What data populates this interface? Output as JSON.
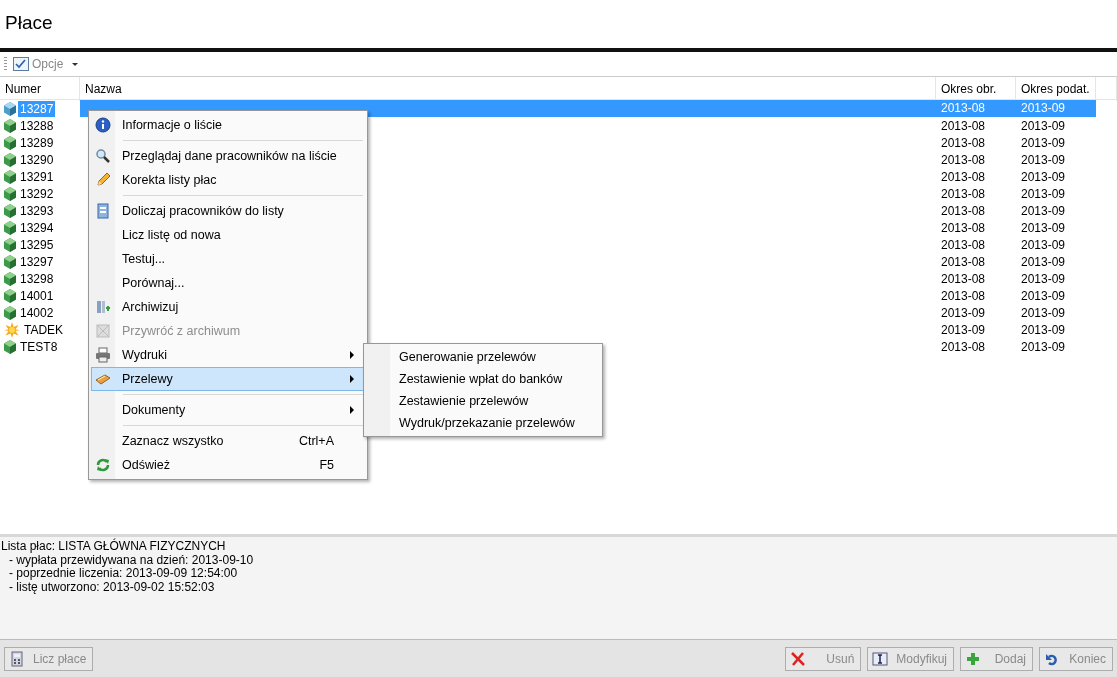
{
  "window": {
    "title": "Płace"
  },
  "toolbar": {
    "options_button": "Opcje"
  },
  "table": {
    "columns": [
      "Numer",
      "Nazwa",
      "Okres obr.",
      "Okres podat."
    ],
    "rows": [
      {
        "numer": "13287",
        "okres_obr": "2013-08",
        "okres_podat": "2013-09",
        "selected": true,
        "kind": "list"
      },
      {
        "numer": "13288",
        "okres_obr": "2013-08",
        "okres_podat": "2013-09",
        "selected": false,
        "kind": "list"
      },
      {
        "numer": "13289",
        "okres_obr": "2013-08",
        "okres_podat": "2013-09",
        "selected": false,
        "kind": "list"
      },
      {
        "numer": "13290",
        "okres_obr": "2013-08",
        "okres_podat": "2013-09",
        "selected": false,
        "kind": "list"
      },
      {
        "numer": "13291",
        "okres_obr": "2013-08",
        "okres_podat": "2013-09",
        "selected": false,
        "kind": "list"
      },
      {
        "numer": "13292",
        "okres_obr": "2013-08",
        "okres_podat": "2013-09",
        "selected": false,
        "kind": "list"
      },
      {
        "numer": "13293",
        "okres_obr": "2013-08",
        "okres_podat": "2013-09",
        "selected": false,
        "kind": "list"
      },
      {
        "numer": "13294",
        "okres_obr": "2013-08",
        "okres_podat": "2013-09",
        "selected": false,
        "kind": "list"
      },
      {
        "numer": "13295",
        "okres_obr": "2013-08",
        "okres_podat": "2013-09",
        "selected": false,
        "kind": "list"
      },
      {
        "numer": "13297",
        "okres_obr": "2013-08",
        "okres_podat": "2013-09",
        "selected": false,
        "kind": "list"
      },
      {
        "numer": "13298",
        "okres_obr": "2013-08",
        "okres_podat": "2013-09",
        "selected": false,
        "kind": "list"
      },
      {
        "numer": "14001",
        "okres_obr": "2013-08",
        "okres_podat": "2013-09",
        "selected": false,
        "kind": "list"
      },
      {
        "numer": "14002",
        "okres_obr": "2013-09",
        "okres_podat": "2013-09",
        "selected": false,
        "kind": "list"
      },
      {
        "numer": "TADEK",
        "okres_obr": "2013-09",
        "okres_podat": "2013-09",
        "selected": false,
        "kind": "star"
      },
      {
        "numer": "TEST8",
        "okres_obr": "2013-08",
        "okres_podat": "2013-09",
        "selected": false,
        "kind": "list"
      }
    ]
  },
  "context_menu": {
    "items": [
      {
        "kind": "info",
        "label": "Informacje o liście",
        "disabled": false,
        "selected": false,
        "submenu": false
      },
      {
        "kind": "separator"
      },
      {
        "kind": "search",
        "label": "Przeglądaj dane pracowników na liście",
        "disabled": false,
        "selected": false,
        "submenu": false
      },
      {
        "kind": "pencil",
        "label": "Korekta listy płac",
        "disabled": false,
        "selected": false,
        "submenu": false
      },
      {
        "kind": "separator"
      },
      {
        "kind": "doc",
        "label": "Doliczaj pracowników do listy",
        "disabled": false,
        "selected": false,
        "submenu": false
      },
      {
        "kind": "item",
        "label": "Licz listę od nowa",
        "disabled": false,
        "selected": false,
        "submenu": false
      },
      {
        "kind": "item",
        "label": "Testuj...",
        "disabled": false,
        "selected": false,
        "submenu": false
      },
      {
        "kind": "item",
        "label": "Porównaj...",
        "disabled": false,
        "selected": false,
        "submenu": false
      },
      {
        "kind": "archive",
        "label": "Archiwizuj",
        "disabled": false,
        "selected": false,
        "submenu": false
      },
      {
        "kind": "restore",
        "label": "Przywróć z archiwum",
        "disabled": true,
        "selected": false,
        "submenu": false
      },
      {
        "kind": "printer",
        "label": "Wydruki",
        "disabled": false,
        "selected": false,
        "submenu": true
      },
      {
        "kind": "money",
        "label": "Przelewy",
        "disabled": false,
        "selected": true,
        "submenu": true
      },
      {
        "kind": "separator"
      },
      {
        "kind": "item",
        "label": "Dokumenty",
        "disabled": false,
        "selected": false,
        "submenu": true
      },
      {
        "kind": "separator"
      },
      {
        "kind": "item",
        "label": "Zaznacz wszystko",
        "shortcut": "Ctrl+A",
        "disabled": false,
        "selected": false,
        "submenu": false
      },
      {
        "kind": "refresh",
        "label": "Odśwież",
        "shortcut": "F5",
        "disabled": false,
        "selected": false,
        "submenu": false
      }
    ]
  },
  "submenu": {
    "items": [
      "Generowanie przelewów",
      "Zestawienie wpłat do banków",
      "Zestawienie przelewów",
      "Wydruk/przekazanie przelewów"
    ]
  },
  "info_panel": {
    "lines": [
      "Lista płac: LISTA GŁÓWNA FIZYCZNYCH",
      "- wypłata przewidywana na dzień: 2013-09-10",
      "- poprzednie liczenia: 2013-09-09 12:54:00",
      "- listę utworzono: 2013-09-02 15:52:03"
    ]
  },
  "footer": {
    "left": [
      {
        "label": "Licz płace",
        "kind": "calculator",
        "disabled": true
      }
    ],
    "right": [
      {
        "label": "Usuń",
        "kind": "delete",
        "disabled": true
      },
      {
        "label": "Modyfikuj",
        "kind": "edit",
        "disabled": true
      },
      {
        "label": "Dodaj",
        "kind": "add",
        "disabled": true
      },
      {
        "label": "Koniec",
        "kind": "undo",
        "disabled": true
      }
    ]
  }
}
